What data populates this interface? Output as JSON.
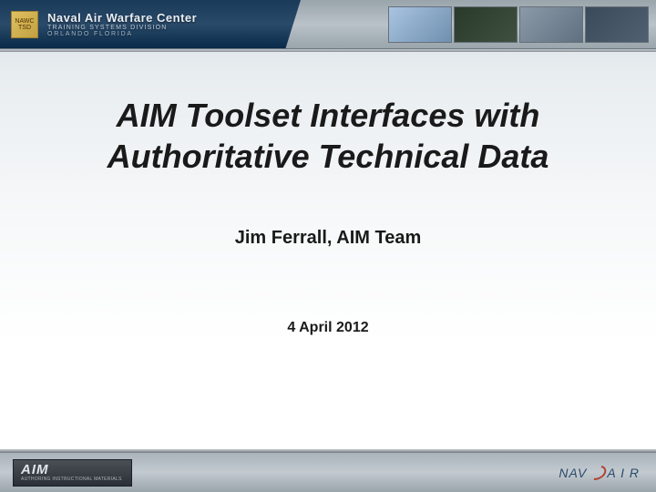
{
  "header": {
    "org_title": "Naval Air Warfare Center",
    "org_division": "TRAINING SYSTEMS DIVISION",
    "org_location": "ORLANDO FLORIDA",
    "badge_text": "NAWC TSD"
  },
  "content": {
    "title_line1": "AIM Toolset Interfaces with",
    "title_line2": "Authoritative Technical Data",
    "author": "Jim Ferrall, AIM Team",
    "date": "4 April 2012"
  },
  "footer": {
    "aim_logo_text": "AIM",
    "aim_logo_sub": "AUTHORING INSTRUCTIONAL MATERIALS",
    "navair_prefix": "NAV",
    "navair_suffix": "A I R"
  }
}
